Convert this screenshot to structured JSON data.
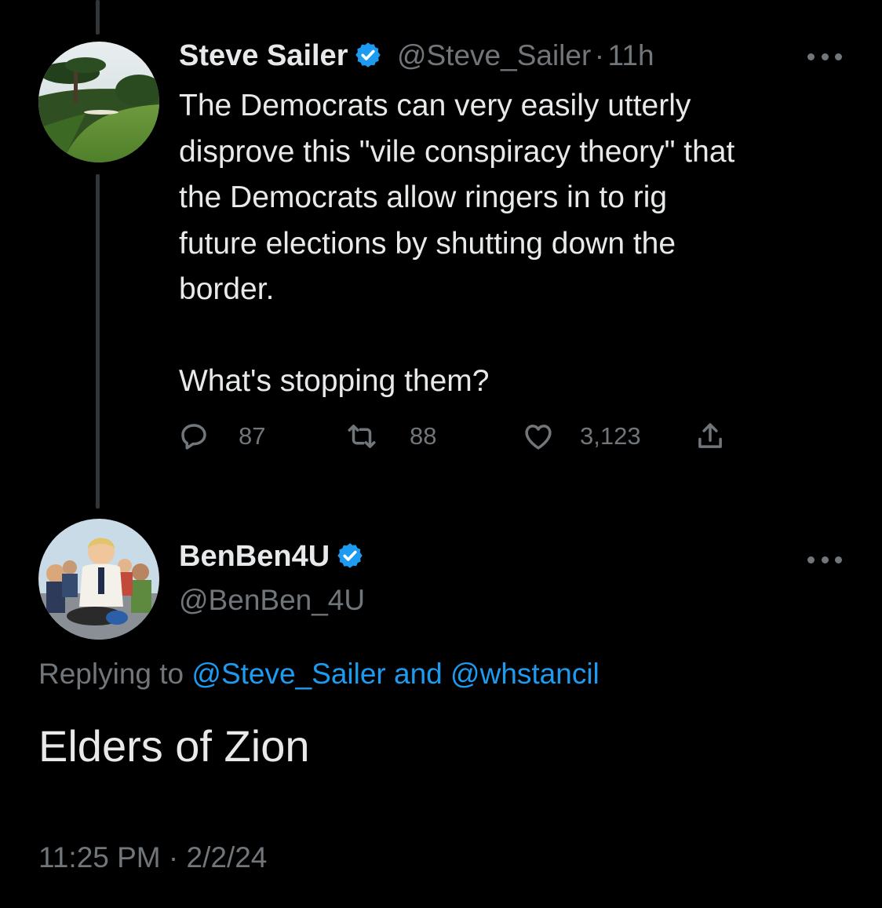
{
  "parent_tweet": {
    "display_name": "Steve Sailer",
    "handle": "@Steve_Sailer",
    "time_sep": "·",
    "time": "11h",
    "text": "The Democrats can very easily utterly\ndisprove this \"vile conspiracy theory\" that\nthe Democrats allow ringers in to rig\nfuture elections by shutting down the\nborder.\n\nWhat's stopping them?",
    "replies": "87",
    "retweets": "88",
    "likes": "3,123"
  },
  "reply_tweet": {
    "display_name": "BenBen4U",
    "handle": "@BenBen_4U",
    "replying_prefix": "Replying to ",
    "replying_user1": "@Steve_Sailer",
    "replying_and": " and ",
    "replying_user2": "@whstancil",
    "text": "Elders of Zion",
    "timestamp": "11:25 PM · 2/2/24"
  },
  "colors": {
    "background": "#000000",
    "text": "#e7e9ea",
    "muted": "#71767b",
    "accent": "#1d9bf0",
    "thread_line": "#333639"
  },
  "icons": [
    "verified-badge-icon",
    "more-options-icon",
    "reply-icon",
    "retweet-icon",
    "like-icon",
    "share-icon"
  ]
}
